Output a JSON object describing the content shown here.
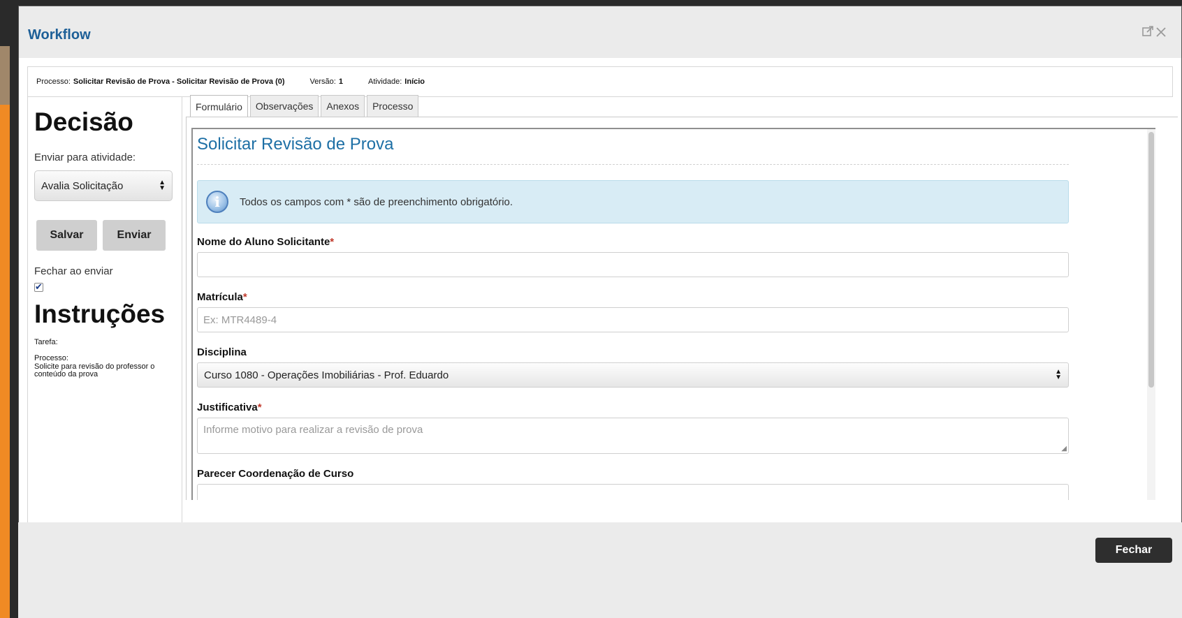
{
  "window": {
    "title": "Workflow"
  },
  "process_bar": {
    "processo_label": "Processo:",
    "processo_value": "Solicitar Revisão de Prova - Solicitar Revisão de Prova (0)",
    "versao_label": "Versão:",
    "versao_value": "1",
    "atividade_label": "Atividade:",
    "atividade_value": "Início"
  },
  "left_panel": {
    "decisao_heading": "Decisão",
    "enviar_label": "Enviar para atividade:",
    "enviar_selected": "Avalia Solicitação",
    "save_button": "Salvar",
    "send_button": "Enviar",
    "close_on_send_label": "Fechar ao enviar",
    "close_on_send_checked": true,
    "instrucoes_heading": "Instruções",
    "tarefa_label": "Tarefa:",
    "processo_label": "Processo:",
    "processo_text": "Solicite para revisão do professor o conteúdo da prova"
  },
  "tabs": [
    {
      "label": "Formulário",
      "active": true
    },
    {
      "label": "Observações",
      "active": false
    },
    {
      "label": "Anexos",
      "active": false
    },
    {
      "label": "Processo",
      "active": false
    }
  ],
  "form": {
    "title": "Solicitar Revisão de Prova",
    "info_message": "Todos os campos com * são de preenchimento obrigatório.",
    "fields": {
      "nome": {
        "label": "Nome do Aluno Solicitante",
        "required_mark": "*",
        "value": ""
      },
      "matricula": {
        "label": "Matrícula",
        "required_mark": "*",
        "placeholder": "Ex: MTR4489-4"
      },
      "disciplina": {
        "label": "Disciplina",
        "selected": "Curso 1080 - Operações Imobiliárias - Prof. Eduardo"
      },
      "justificativa": {
        "label": "Justificativa",
        "required_mark": "*",
        "placeholder": "Informe motivo para realizar a revisão de prova"
      },
      "parecer": {
        "label": "Parecer Coordenação de Curso",
        "value": ""
      }
    }
  },
  "footer": {
    "close_button": "Fechar"
  },
  "colors": {
    "title_blue": "#1d5f97",
    "form_title_blue": "#1d6fa5",
    "required_red": "#c0392b",
    "info_bg": "#d8ecf5",
    "background_orange": "#f08a24"
  },
  "icons": {
    "header": [
      "popout-icon",
      "close-icon"
    ],
    "info": "info-icon"
  }
}
